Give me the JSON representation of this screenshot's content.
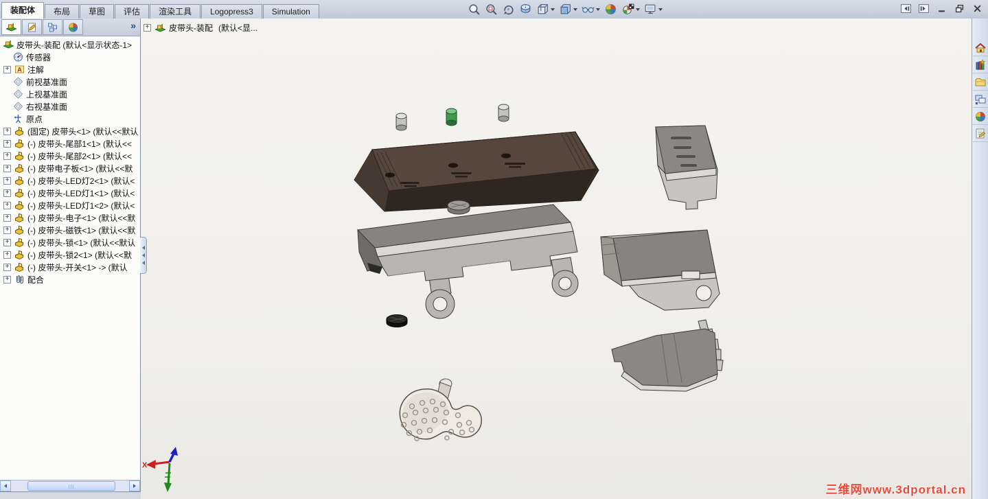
{
  "ribbon": {
    "tabs": [
      {
        "label": "装配体",
        "active": true
      },
      {
        "label": "布局",
        "active": false
      },
      {
        "label": "草图",
        "active": false
      },
      {
        "label": "评估",
        "active": false
      },
      {
        "label": "渲染工具",
        "active": false
      },
      {
        "label": "Logopress3",
        "active": false
      },
      {
        "label": "Simulation",
        "active": false
      }
    ]
  },
  "view_toolbar": {
    "icons": [
      {
        "name": "zoom-fit-icon",
        "dropdown": false
      },
      {
        "name": "zoom-area-icon",
        "dropdown": false
      },
      {
        "name": "rotate-view-icon",
        "dropdown": false
      },
      {
        "name": "section-view-icon",
        "dropdown": false
      },
      {
        "name": "view-orientation-icon",
        "dropdown": true
      },
      {
        "name": "display-style-icon",
        "dropdown": true
      },
      {
        "name": "hide-show-icon",
        "dropdown": true
      },
      {
        "name": "edit-appearance-icon",
        "dropdown": false
      },
      {
        "name": "apply-scene-icon",
        "dropdown": true
      },
      {
        "name": "view-settings-icon",
        "dropdown": true
      }
    ]
  },
  "window_controls": [
    {
      "name": "collapse-left"
    },
    {
      "name": "collapse-right"
    },
    {
      "name": "minimize"
    },
    {
      "name": "restore"
    },
    {
      "name": "close"
    }
  ],
  "feature_panel": {
    "tabs": [
      {
        "name": "featuremanager-tab",
        "active": true
      },
      {
        "name": "propertymanager-tab",
        "active": false
      },
      {
        "name": "configurationmanager-tab",
        "active": false
      },
      {
        "name": "displaymanager-tab",
        "active": false
      }
    ],
    "overflow_chevron": "»",
    "tree": [
      {
        "icon": "assembly",
        "label": "皮带头-装配    (默认<显示状态-1>",
        "plus": false,
        "root": true
      },
      {
        "icon": "sensor",
        "label": "传感器",
        "plus": false
      },
      {
        "icon": "annotations",
        "label": "注解",
        "plus": true
      },
      {
        "icon": "plane",
        "label": "前视基准面",
        "plus": false
      },
      {
        "icon": "plane",
        "label": "上视基准面",
        "plus": false
      },
      {
        "icon": "plane",
        "label": "右视基准面",
        "plus": false
      },
      {
        "icon": "origin",
        "label": "原点",
        "plus": false
      },
      {
        "icon": "part",
        "label": "(固定) 皮带头<1> (默认<<默认",
        "plus": true
      },
      {
        "icon": "part",
        "label": "(-) 皮带头-尾部1<1> (默认<<",
        "plus": true
      },
      {
        "icon": "part",
        "label": "(-) 皮带头-尾部2<1> (默认<<",
        "plus": true
      },
      {
        "icon": "part",
        "label": "(-) 皮带电子板<1> (默认<<默",
        "plus": true
      },
      {
        "icon": "part",
        "label": "(-) 皮带头-LED灯2<1> (默认<",
        "plus": true
      },
      {
        "icon": "part",
        "label": "(-) 皮带头-LED灯1<1> (默认<",
        "plus": true
      },
      {
        "icon": "part",
        "label": "(-) 皮带头-LED灯1<2> (默认<",
        "plus": true
      },
      {
        "icon": "part",
        "label": "(-) 皮带头-电子<1> (默认<<默",
        "plus": true
      },
      {
        "icon": "part",
        "label": "(-) 皮带头-磁铁<1> (默认<<默",
        "plus": true
      },
      {
        "icon": "part",
        "label": "(-) 皮带头-锁<1> (默认<<默认",
        "plus": true
      },
      {
        "icon": "part",
        "label": "(-) 皮带头-锁2<1> (默认<<默",
        "plus": true
      },
      {
        "icon": "part",
        "label": "(-) 皮带头-开关<1> -> (默认",
        "plus": true
      },
      {
        "icon": "mates",
        "label": "配合",
        "plus": true
      }
    ]
  },
  "viewport": {
    "breadcrumb": {
      "label": "皮带头-装配",
      "suffix": "(默认<显..."
    },
    "watermark": "三维网www.3dportal.cn",
    "triad_x_label": "X"
  },
  "task_pane": {
    "icons": [
      {
        "name": "home-icon"
      },
      {
        "name": "design-library-icon"
      },
      {
        "name": "file-explorer-icon"
      },
      {
        "name": "view-palette-icon"
      },
      {
        "name": "appearances-icon"
      },
      {
        "name": "custom-properties-icon"
      }
    ]
  },
  "colors": {
    "cover_brown": "#3c312a",
    "body_gray": "#b9b6af",
    "led_green": "#3f9a4c",
    "watermark_red": "#f04838"
  }
}
